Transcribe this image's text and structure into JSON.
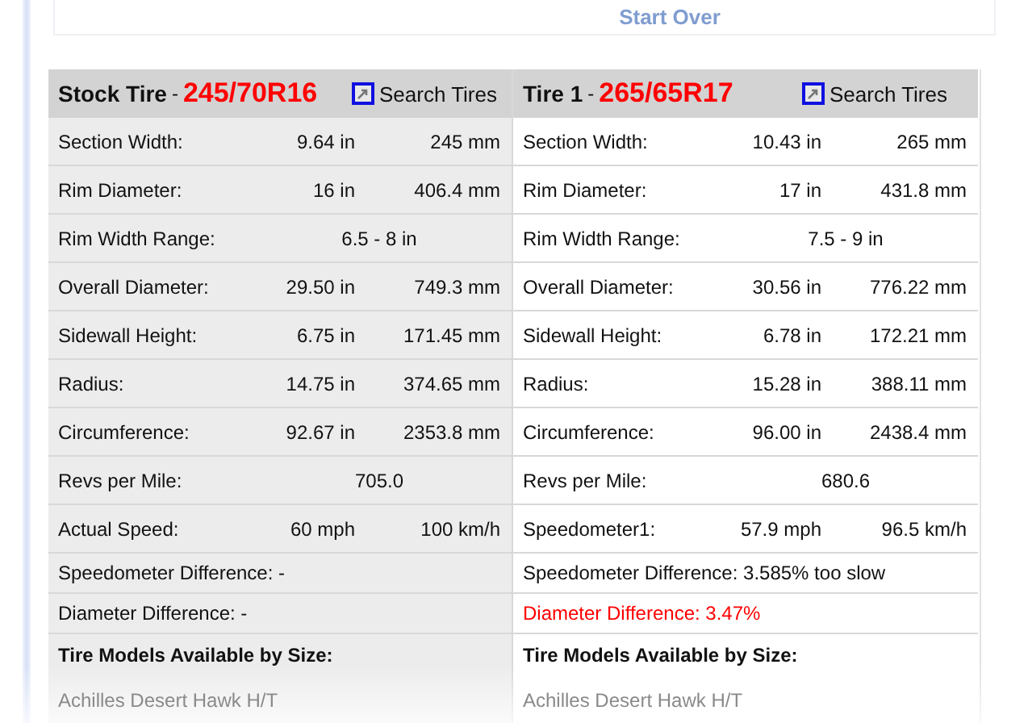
{
  "start_over": "Start Over",
  "tires": [
    {
      "title": "Stock Tire",
      "separator": "-",
      "size": "245/70R16",
      "search_label": "Search Tires",
      "rows": [
        {
          "kind": "pair",
          "label": "Section Width:",
          "in": "9.64 in",
          "mm": "245 mm"
        },
        {
          "kind": "pair",
          "label": "Rim Diameter:",
          "in": "16 in",
          "mm": "406.4 mm"
        },
        {
          "kind": "single",
          "label": "Rim Width Range:",
          "value": "6.5 - 8 in"
        },
        {
          "kind": "pair",
          "label": "Overall Diameter:",
          "in": "29.50 in",
          "mm": "749.3 mm"
        },
        {
          "kind": "pair",
          "label": "Sidewall Height:",
          "in": "6.75 in",
          "mm": "171.45 mm"
        },
        {
          "kind": "pair",
          "label": "Radius:",
          "in": "14.75 in",
          "mm": "374.65 mm"
        },
        {
          "kind": "pair",
          "label": "Circumference:",
          "in": "92.67 in",
          "mm": "2353.8 mm"
        },
        {
          "kind": "single",
          "label": "Revs per Mile:",
          "value": "705.0"
        },
        {
          "kind": "pair",
          "label": "Actual Speed:",
          "in": "60 mph",
          "mm": "100 km/h"
        }
      ],
      "speedometer_difference": "Speedometer Difference: -",
      "diameter_difference": {
        "text": "Diameter Difference: -",
        "alert": false
      },
      "models_heading": "Tire Models Available by Size:",
      "models": [
        "Achilles Desert Hawk H/T"
      ]
    },
    {
      "title": "Tire 1",
      "separator": "-",
      "size": "265/65R17",
      "search_label": "Search Tires",
      "rows": [
        {
          "kind": "pair",
          "label": "Section Width:",
          "in": "10.43 in",
          "mm": "265 mm"
        },
        {
          "kind": "pair",
          "label": "Rim Diameter:",
          "in": "17 in",
          "mm": "431.8 mm"
        },
        {
          "kind": "single",
          "label": "Rim Width Range:",
          "value": "7.5 - 9 in"
        },
        {
          "kind": "pair",
          "label": "Overall Diameter:",
          "in": "30.56 in",
          "mm": "776.22 mm"
        },
        {
          "kind": "pair",
          "label": "Sidewall Height:",
          "in": "6.78 in",
          "mm": "172.21 mm"
        },
        {
          "kind": "pair",
          "label": "Radius:",
          "in": "15.28 in",
          "mm": "388.11 mm"
        },
        {
          "kind": "pair",
          "label": "Circumference:",
          "in": "96.00 in",
          "mm": "2438.4 mm"
        },
        {
          "kind": "single",
          "label": "Revs per Mile:",
          "value": "680.6"
        },
        {
          "kind": "pair",
          "label": "Speedometer1:",
          "in": "57.9 mph",
          "mm": "96.5 km/h"
        }
      ],
      "speedometer_difference": "Speedometer Difference: 3.585% too slow",
      "diameter_difference": {
        "text": "Diameter Difference: 3.47%",
        "alert": true
      },
      "models_heading": "Tire Models Available by Size:",
      "models": [
        "Achilles Desert Hawk H/T"
      ]
    }
  ]
}
